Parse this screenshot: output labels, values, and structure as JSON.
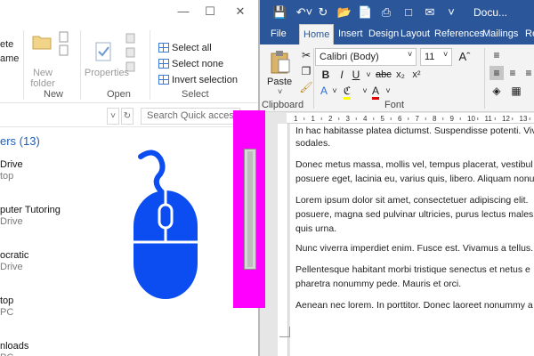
{
  "explorer": {
    "ribbon": {
      "new_folder_label": "New\nfolder",
      "properties_label": "Properties",
      "select_all": "Select all",
      "select_none": "Select none",
      "invert_selection": "Invert selection",
      "group_new": "New",
      "group_open": "Open",
      "group_select": "Select",
      "clipped_left_1": "ete",
      "clipped_left_2": "ame"
    },
    "search": {
      "placeholder": "Search Quick access"
    },
    "section_title": "ers (13)",
    "favorites": [
      {
        "name": "Drive",
        "sub": "top"
      },
      {
        "name": "puter Tutoring",
        "sub": "Drive"
      },
      {
        "name": "ocratic",
        "sub": "Drive"
      },
      {
        "name": "top",
        "sub": "PC"
      },
      {
        "name": "nloads",
        "sub": "PC"
      }
    ]
  },
  "word": {
    "title": "Docu...",
    "tabs": [
      "File",
      "Home",
      "Insert",
      "Design",
      "Layout",
      "References",
      "Mailings",
      "Re"
    ],
    "font_name": "Calibri (Body)",
    "font_size": "11",
    "paste_label": "Paste",
    "group_clipboard": "Clipboard",
    "group_font": "Font",
    "ruler_ticks": [
      "1",
      "1",
      "2",
      "3",
      "4",
      "5",
      "6",
      "7",
      "8",
      "9",
      "10",
      "11",
      "12",
      "13"
    ],
    "paragraphs": [
      "In hac habitasse platea dictumst. Suspendisse potenti. Viv",
      "sodales.",
      "Donec metus massa, mollis vel, tempus placerat, vestibul",
      "posuere eget, lacinia eu, varius quis, libero. Aliquam nonu",
      "Lorem ipsum dolor sit amet, consectetuer adipiscing elit.",
      "posuere, magna sed pulvinar ultricies, purus lectus males",
      "quis urna.",
      "Nunc viverra imperdiet enim. Fusce est. Vivamus a tellus.",
      "Pellentesque habitant morbi tristique senectus et netus e",
      "pharetra nonummy pede. Mauris et orci.",
      "Aenean nec lorem. In porttitor. Donec laoreet nonummy a"
    ]
  },
  "colors": {
    "word_blue": "#2b579a",
    "handle_magenta": "#ff00ff",
    "mouse_blue": "#0b4df0"
  }
}
